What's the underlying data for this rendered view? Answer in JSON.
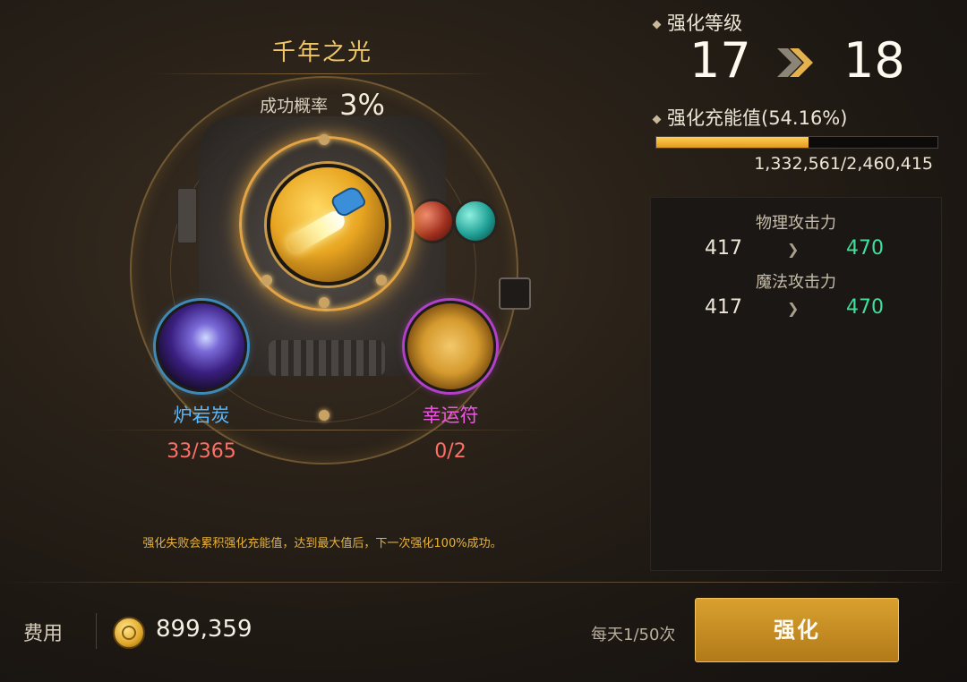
{
  "item": {
    "name": "千年之光",
    "success_rate_label": "成功概率",
    "success_rate_value": "3%"
  },
  "materials": [
    {
      "name": "炉岩炭",
      "count": "33/365",
      "icon": "lava-coal-icon",
      "ring_color": "#3f89b8"
    },
    {
      "name": "幸运符",
      "count": "0/2",
      "icon": "lucky-charm-icon",
      "ring_color": "#b240c8"
    }
  ],
  "hint": "强化失败会累积强化充能值，达到最大值后，下一次强化100%成功。",
  "level": {
    "title": "强化等级",
    "from": "17",
    "to": "18"
  },
  "charge": {
    "title": "强化充能值(54.16%)",
    "percent": 54.16,
    "numbers": "1,332,561/2,460,415"
  },
  "stats": [
    {
      "name": "物理攻击力",
      "old": "417",
      "new": "470"
    },
    {
      "name": "魔法攻击力",
      "old": "417",
      "new": "470"
    }
  ],
  "footer": {
    "cost_label": "费用",
    "cost_value": "899,359",
    "daily_limit": "每天1/50次",
    "enhance_button": "强化"
  },
  "colors": {
    "accent_gold": "#e3a445",
    "stat_increase": "#3ee09c",
    "insufficient": "#ff6f66"
  }
}
